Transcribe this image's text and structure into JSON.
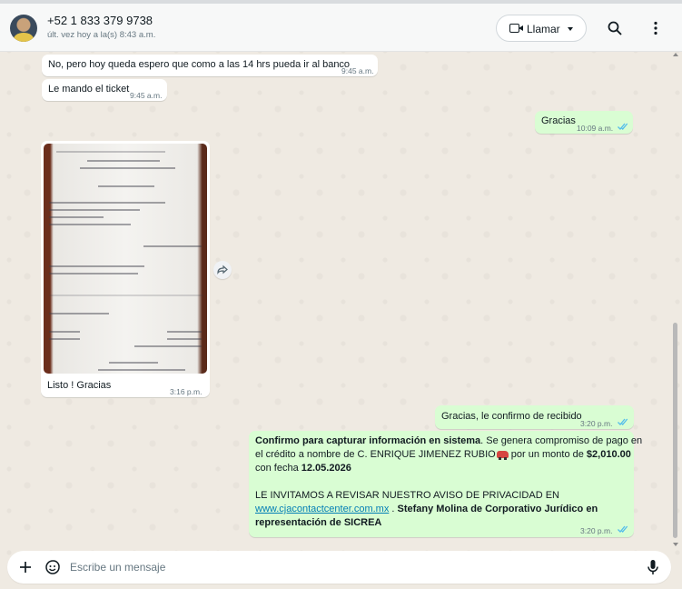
{
  "header": {
    "contact_name": "+52 1 833 379 9738",
    "last_seen": "últ. vez hoy a la(s) 8:43 a.m.",
    "call_label": "Llamar",
    "icons": [
      "search-icon",
      "more-vert-icon",
      "video-camera-icon",
      "chevron-down-icon"
    ]
  },
  "messages": [
    {
      "dir": "in",
      "text": "No, pero hoy queda espero que como a las 14 hrs pueda ir al banco",
      "time": "9:45 a.m."
    },
    {
      "dir": "in",
      "text": "Le mando el ticket",
      "time": "9:45 a.m."
    },
    {
      "dir": "out",
      "text": "Gracias",
      "time": "10:09 a.m.",
      "status": "read"
    },
    {
      "dir": "in",
      "type": "image",
      "caption": "Listo ! Gracias",
      "time": "3:16 p.m."
    },
    {
      "dir": "out",
      "text": "Gracias, le confirmo de recibido",
      "time": "3:20 p.m.",
      "status": "read"
    },
    {
      "dir": "out",
      "time": "3:20 p.m.",
      "status": "read",
      "p1_bold": "Confirmo para capturar información en sistema",
      "p1_rest": ". Se genera compromiso de pago en",
      "p2": "el crédito a nombre de C. ENRIQUE JIMENEZ RUBIO",
      "p2_after": " por un monto de ",
      "p2_amount": "$2,010.00",
      "p3": "con fecha ",
      "p3_date": "12.05.2026",
      "p4": "LE INVITAMOS A REVISAR NUESTRO AVISO DE PRIVACIDAD EN",
      "p5_link": "www.cjacontactcenter.com.mx",
      "p5_rest": " . ",
      "p5_bold": "Stefany Molina de Corporativo Jurídico en",
      "p6_bold": "representación de SICREA"
    }
  ],
  "composer": {
    "placeholder": "Escribe un mensaje",
    "icons": [
      "plus-icon",
      "sticker-icon",
      "microphone-icon"
    ]
  },
  "colors": {
    "chat_bg": "#efeae2",
    "outgoing_bubble": "#d9fdd3",
    "incoming_bubble": "#ffffff",
    "read_ticks": "#53bdeb",
    "link": "#027eb5"
  }
}
